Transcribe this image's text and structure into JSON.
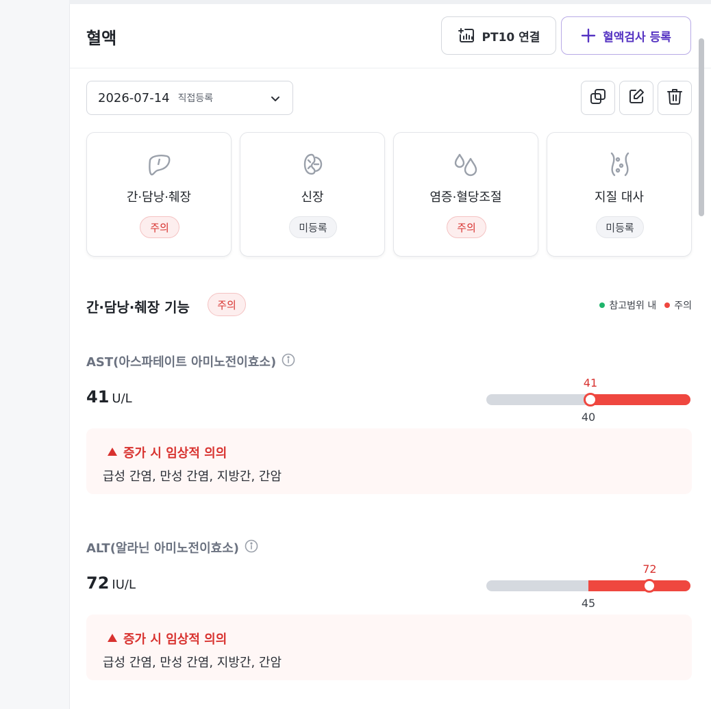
{
  "header": {
    "title": "혈액",
    "pt10_button": "PT10 연결",
    "add_button": "혈액검사 등록"
  },
  "date_select": {
    "date": "2026-07-14",
    "type": "직접등록"
  },
  "toolbar_icons": [
    "copy-icon",
    "edit-icon",
    "trash-icon"
  ],
  "categories": [
    {
      "label": "간·담낭·췌장",
      "status": "주의",
      "icon": "liver-icon"
    },
    {
      "label": "신장",
      "status": "미등록",
      "icon": "kidney-icon"
    },
    {
      "label": "염증·혈당조절",
      "status": "주의",
      "icon": "drops-icon"
    },
    {
      "label": "지질 대사",
      "status": "미등록",
      "icon": "lipid-icon"
    }
  ],
  "section": {
    "title": "간·담낭·췌장 기능",
    "status": "주의",
    "legend_normal": "참고범위 내",
    "legend_warn": "주의",
    "normal_color": "#1fb46b",
    "warn_color": "#ef473f"
  },
  "tests": [
    {
      "name": "AST(아스파테이트 아미노전이효소)",
      "value": "41",
      "unit": "U/L",
      "reference": "40",
      "reference_fraction": 0.5,
      "value_fraction": 0.51,
      "note_title": "증가 시 임상적 의의",
      "note_body": "급성 간염, 만성 간염, 지방간, 간암"
    },
    {
      "name": "ALT(알라닌 아미노전이효소)",
      "value": "72",
      "unit": "IU/L",
      "reference": "45",
      "reference_fraction": 0.5,
      "value_fraction": 0.8,
      "note_title": "증가 시 임상적 의의",
      "note_body": "급성 간염, 만성 간염, 지방간, 간암"
    }
  ]
}
